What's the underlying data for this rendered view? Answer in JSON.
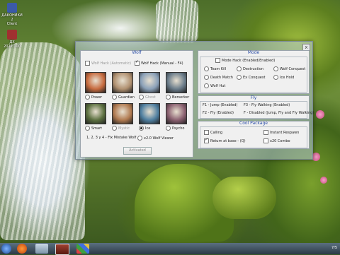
{
  "desktop": {
    "icons": [
      {
        "label": "ДАКОНИКИ 2",
        "sub": "Client"
      },
      {
        "label": "ДХ",
        "sub": "2022 100"
      }
    ]
  },
  "dialog": {
    "close_label": "x",
    "wolf": {
      "title": "Wolf",
      "hack_automatic": {
        "label": "Wolf Hack (Automatic)",
        "checked": false,
        "disabled": true
      },
      "hack_manual": {
        "label": "Wolf Hack (Manual - F4)",
        "checked": true
      },
      "portraits": [
        {
          "label": "Power",
          "selected": false,
          "disabled": false,
          "color": "#c76b3f"
        },
        {
          "label": "Guardian",
          "selected": false,
          "disabled": false,
          "color": "#b09070"
        },
        {
          "label": "Ghost",
          "selected": false,
          "disabled": true,
          "color": "#8aa0b8"
        },
        {
          "label": "Berserker",
          "selected": false,
          "disabled": false,
          "color": "#6a7c8a"
        },
        {
          "label": "Smart",
          "selected": false,
          "disabled": false,
          "color": "#5c7040"
        },
        {
          "label": "Mystic",
          "selected": false,
          "disabled": true,
          "color": "#b07a50"
        },
        {
          "label": "Ice",
          "selected": true,
          "disabled": false,
          "color": "#4f7fa0"
        },
        {
          "label": "Psycho",
          "selected": false,
          "disabled": false,
          "color": "#8a6070"
        }
      ],
      "footer_text": "1, 2, 3 y 4 - Fix Mistake Wolf",
      "viewer": {
        "label": "x2.0 Wolf Viewer",
        "checked": false
      },
      "activated_button": "Activated"
    },
    "mode": {
      "title": "Mode",
      "hack": {
        "label": "Mode Hack (Enabled/Enabled)",
        "checked": false
      },
      "options": [
        {
          "label": "Team Kill",
          "checked": false
        },
        {
          "label": "Destruction",
          "checked": false
        },
        {
          "label": "Wolf Conquest",
          "checked": false
        },
        {
          "label": "Death Match",
          "checked": false
        },
        {
          "label": "Ex Conquest",
          "checked": false
        },
        {
          "label": "Ice Hold",
          "checked": false
        },
        {
          "label": "Wolf Hut",
          "checked": false
        }
      ]
    },
    "fly": {
      "title": "Fly",
      "lines": [
        [
          "F1 - Jump (Enabled)",
          "F3 - Fly Walking (Enabled)"
        ],
        [
          "F2 - Fly (Enabled)",
          "F - Disabled (Jump, Fly and Fly Walking)"
        ]
      ]
    },
    "cool_package": {
      "title": "Cool Package",
      "options": [
        {
          "label": "Calling",
          "checked": false
        },
        {
          "label": "Instant Respawn",
          "checked": false
        },
        {
          "label": "Return at base - (Q)",
          "checked": true
        },
        {
          "label": "x20 Combo",
          "checked": false
        }
      ]
    }
  },
  "taskbar": {
    "clock": "7/5"
  },
  "colors": {
    "title_blue": "#2b4ea8",
    "panel_bg": "#f0f0f0"
  }
}
